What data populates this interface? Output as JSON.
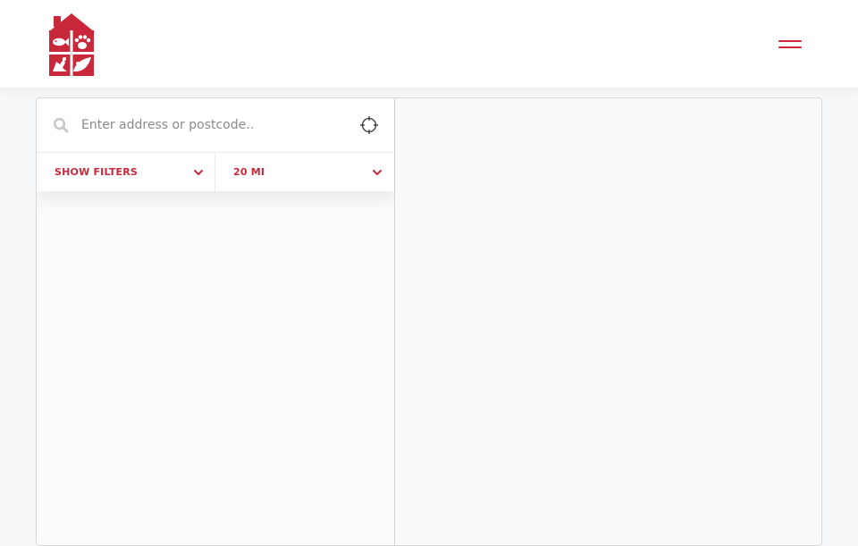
{
  "header": {
    "logo_icon": "pet-house-logo-icon",
    "menu_icon": "hamburger-menu-icon"
  },
  "search": {
    "placeholder": "Enter address or postcode..",
    "value": "",
    "search_icon": "search-icon",
    "locate_icon": "crosshair-locate-icon"
  },
  "filters": {
    "show_filters_label": "SHOW FILTERS",
    "radius_label": "20 MI"
  },
  "colors": {
    "brand": "#c9283a",
    "search_icon": "#c8c8c8"
  }
}
